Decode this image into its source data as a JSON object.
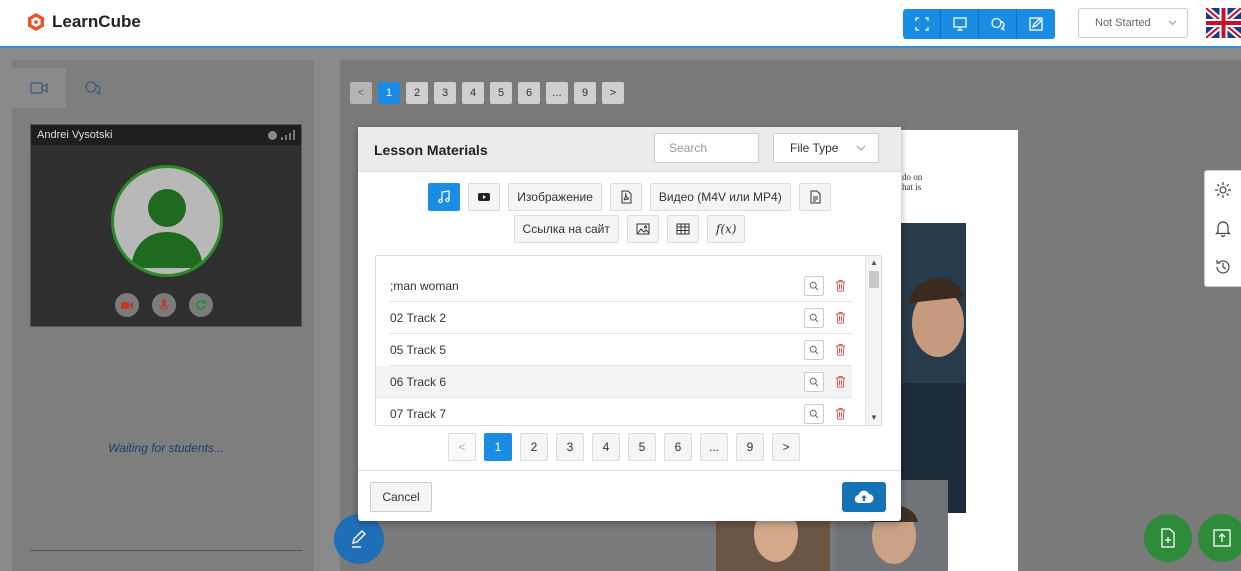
{
  "app": {
    "name": "LearnCube"
  },
  "header": {
    "status_select": "Not Started",
    "mode_icons": [
      "fullscreen-icon",
      "whiteboard-icon",
      "chat-icon",
      "edit-icon"
    ],
    "accent": "#1b8ce3"
  },
  "left_panel": {
    "tabs": [
      "video-icon",
      "chat-icon"
    ],
    "participant_name": "Andrei Vysotski",
    "waiting_text": "Waiting for students..."
  },
  "main": {
    "pager": [
      "<",
      "1",
      "2",
      "3",
      "4",
      "5",
      "6",
      "...",
      "9",
      ">"
    ],
    "pager_active": "1",
    "doc_text_lines": [
      "do on",
      "hat is"
    ]
  },
  "modal": {
    "title": "Lesson Materials",
    "search_placeholder": "Search",
    "file_type_label": "File Type",
    "filters_row1": [
      "audio-icon",
      "youtube-icon",
      "Изображение",
      "pdf-icon",
      "Видео (M4V или MP4)",
      "document-icon"
    ],
    "filters_row2": [
      "Ссылка на сайт",
      "image-icon",
      "table-icon",
      "f(x)"
    ],
    "items": [
      {
        "name": ";man woman"
      },
      {
        "name": "02 Track 2"
      },
      {
        "name": "05 Track 5"
      },
      {
        "name": "06 Track 6"
      },
      {
        "name": "07 Track 7"
      }
    ],
    "pager": [
      "<",
      "1",
      "2",
      "3",
      "4",
      "5",
      "6",
      "...",
      "9",
      ">"
    ],
    "pager_active": "1",
    "cancel_label": "Cancel",
    "delete_color": "#d9534f"
  }
}
